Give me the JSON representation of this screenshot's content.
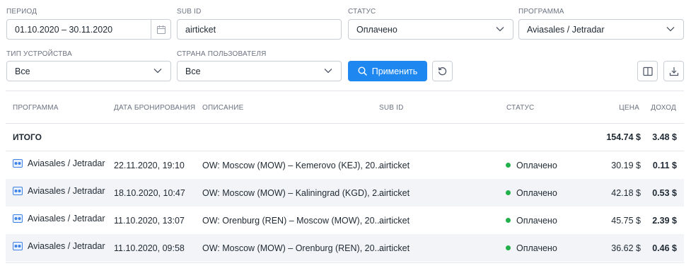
{
  "filters": {
    "period": {
      "label": "ПЕРИОД",
      "value": "01.10.2020 – 30.11.2020"
    },
    "sub_id": {
      "label": "SUB ID",
      "value": "airticket"
    },
    "status": {
      "label": "СТАТУС",
      "value": "Оплачено"
    },
    "program": {
      "label": "ПРОГРАММА",
      "value": "Aviasales / Jetradar"
    },
    "device_type": {
      "label": "ТИП УСТРОЙСТВА",
      "value": "Все"
    },
    "user_country": {
      "label": "СТРАНА ПОЛЬЗОВАТЕЛЯ",
      "value": "Все"
    },
    "apply_label": "Применить"
  },
  "icons": {
    "calendar": "calendar-icon",
    "chevron": "chevron-down-icon",
    "search": "search-icon",
    "reset": "reset-icon",
    "columns": "columns-icon",
    "download": "download-icon",
    "program": "aviasales-icon"
  },
  "colors": {
    "accent": "#1e88f0",
    "status_paid": "#22b04b",
    "row_alt": "#f2f4f8"
  },
  "table": {
    "headers": {
      "program": "ПРОГРАММА",
      "booking_date": "ДАТА БРОНИРОВАНИЯ",
      "description": "ОПИСАНИЕ",
      "sub_id": "SUB ID",
      "status": "СТАТУС",
      "price": "ЦЕНА",
      "income": "ДОХОД"
    },
    "total": {
      "label": "ИТОГО",
      "price": "154.74 $",
      "income": "3.48 $"
    },
    "rows": [
      {
        "program": "Aviasales / Jetradar",
        "date": "22.11.2020, 19:10",
        "description": "OW: Moscow (MOW) – Kemerovo (KEJ), 20...",
        "sub_id": "airticket",
        "status": "Оплачено",
        "price": "30.19 $",
        "income": "0.11 $"
      },
      {
        "program": "Aviasales / Jetradar",
        "date": "18.10.2020, 10:47",
        "description": "OW: Moscow (MOW) – Kaliningrad (KGD), 2...",
        "sub_id": "airticket",
        "status": "Оплачено",
        "price": "42.18 $",
        "income": "0.53 $"
      },
      {
        "program": "Aviasales / Jetradar",
        "date": "11.10.2020, 13:07",
        "description": "OW: Orenburg (REN) – Moscow (MOW), 20...",
        "sub_id": "airticket",
        "status": "Оплачено",
        "price": "45.75 $",
        "income": "2.39 $"
      },
      {
        "program": "Aviasales / Jetradar",
        "date": "11.10.2020, 09:58",
        "description": "OW: Moscow (MOW) – Orenburg (REN), 20...",
        "sub_id": "airticket",
        "status": "Оплачено",
        "price": "36.62 $",
        "income": "0.46 $"
      }
    ]
  }
}
